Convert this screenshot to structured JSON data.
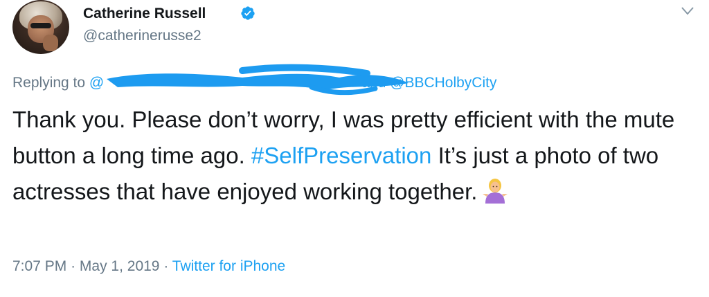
{
  "author": {
    "name": "Catherine Russell",
    "handle": "@catherinerusse2",
    "verified": true
  },
  "reply": {
    "prefix": "Replying to",
    "visible_mention_start": "@",
    "connector": "and",
    "mention": "@BBCHolbyCity"
  },
  "tweet": {
    "text_part1": "Thank you. Please don’t worry, I was pretty efficient with the mute button a long time ago.",
    "hashtag": "#SelfPreservation",
    "text_part2": "It’s just a photo of two actresses that have enjoyed working together.",
    "emoji": "woman-shrugging-emoji"
  },
  "meta": {
    "time": "7:07 PM",
    "separator": "·",
    "date": "May 1, 2019",
    "source": "Twitter for iPhone"
  },
  "colors": {
    "link": "#1da1f2",
    "secondary": "#657786",
    "text": "#14171a",
    "redaction": "#1d9bf0"
  }
}
